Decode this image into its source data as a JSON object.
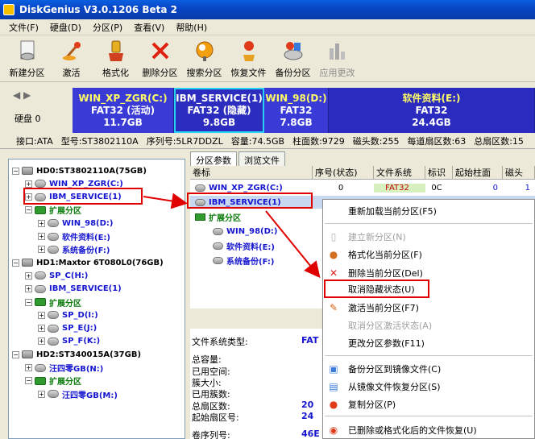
{
  "window": {
    "title": "DiskGenius V3.0.1206 Beta 2"
  },
  "menu": [
    "文件(F)",
    "硬盘(D)",
    "分区(P)",
    "查看(V)",
    "帮助(H)"
  ],
  "toolbar": [
    {
      "label": "新建分区",
      "icon": "new-partition-icon",
      "enabled": true
    },
    {
      "label": "激活",
      "icon": "activate-icon",
      "enabled": true
    },
    {
      "label": "格式化",
      "icon": "format-icon",
      "enabled": true
    },
    {
      "label": "删除分区",
      "icon": "delete-icon",
      "enabled": true
    },
    {
      "label": "搜索分区",
      "icon": "search-icon",
      "enabled": true
    },
    {
      "label": "恢复文件",
      "icon": "recover-icon",
      "enabled": true
    },
    {
      "label": "备份分区",
      "icon": "backup-icon",
      "enabled": true
    },
    {
      "label": "应用更改",
      "icon": "apply-icon",
      "enabled": false
    }
  ],
  "diskbar": {
    "disk_label": "硬盘 0",
    "partitions": [
      {
        "name": "WIN_XP_ZGR(C:)",
        "fs": "FAT32 (活动)",
        "size": "11.7GB"
      },
      {
        "name": "IBM_SERVICE(1)",
        "fs": "FAT32 (隐藏)",
        "size": "9.8GB"
      },
      {
        "name": "WIN_98(D:)",
        "fs": "FAT32",
        "size": "7.8GB"
      },
      {
        "name": "软件资料(E:)",
        "fs": "FAT32",
        "size": "24.4GB"
      }
    ]
  },
  "infobar": [
    "接口:ATA",
    "型号:ST3802110A",
    "序列号:5LR7DDZL",
    "容量:74.5GB",
    "柱面数:9729",
    "磁头数:255",
    "每道扇区数:63",
    "总扇区数:15"
  ],
  "tree": [
    {
      "label": "HD0:ST3802110A(75GB)",
      "color": "black",
      "type": "hd",
      "level": 0,
      "pm": "−"
    },
    {
      "label": "WIN_XP_ZGR(C:)",
      "color": "blue",
      "type": "pt",
      "level": 1,
      "pm": "+"
    },
    {
      "label": "IBM_SERVICE(1)",
      "color": "blue",
      "type": "pt",
      "level": 1,
      "pm": "+"
    },
    {
      "label": "扩展分区",
      "color": "green",
      "type": "ex",
      "level": 1,
      "pm": "−"
    },
    {
      "label": "WIN_98(D:)",
      "color": "blue",
      "type": "pt",
      "level": 2,
      "pm": "+"
    },
    {
      "label": "软件资料(E:)",
      "color": "blue",
      "type": "pt",
      "level": 2,
      "pm": "+"
    },
    {
      "label": "系统备份(F:)",
      "color": "blue",
      "type": "pt",
      "level": 2,
      "pm": "+"
    },
    {
      "label": "HD1:Maxtor 6T080L0(76GB)",
      "color": "black",
      "type": "hd",
      "level": 0,
      "pm": "−"
    },
    {
      "label": "SP_C(H:)",
      "color": "blue",
      "type": "pt",
      "level": 1,
      "pm": "+"
    },
    {
      "label": "IBM_SERVICE(1)",
      "color": "blue",
      "type": "pt",
      "level": 1,
      "pm": "+"
    },
    {
      "label": "扩展分区",
      "color": "green",
      "type": "ex",
      "level": 1,
      "pm": "−"
    },
    {
      "label": "SP_D(I:)",
      "color": "blue",
      "type": "pt",
      "level": 2,
      "pm": "+"
    },
    {
      "label": "SP_E(J:)",
      "color": "blue",
      "type": "pt",
      "level": 2,
      "pm": "+"
    },
    {
      "label": "SP_F(K:)",
      "color": "blue",
      "type": "pt",
      "level": 2,
      "pm": "+"
    },
    {
      "label": "HD2:ST340015A(37GB)",
      "color": "black",
      "type": "hd",
      "level": 0,
      "pm": "−"
    },
    {
      "label": "汪四零GB(N:)",
      "color": "blue",
      "type": "pt",
      "level": 1,
      "pm": "+"
    },
    {
      "label": "扩展分区",
      "color": "green",
      "type": "ex",
      "level": 1,
      "pm": "−"
    },
    {
      "label": "汪四零GB(M:)",
      "color": "blue",
      "type": "pt",
      "level": 2,
      "pm": "+"
    }
  ],
  "tabs": [
    "分区参数",
    "浏览文件"
  ],
  "columns": [
    "卷标",
    "序号(状态)",
    "文件系统",
    "标识",
    "起始柱面",
    "磁头"
  ],
  "rows": [
    {
      "label": "WIN_XP_ZGR(C:)",
      "num": "0",
      "fs": "FAT32",
      "id": "0C",
      "cyl": "0",
      "head": "1",
      "color": "blue",
      "level": 0
    },
    {
      "label": "IBM_SERVICE(1)",
      "num": "",
      "fs": "",
      "id": "",
      "cyl": "",
      "head": "",
      "color": "blue",
      "level": 0
    },
    {
      "label": "扩展分区",
      "num": "",
      "fs": "",
      "id": "",
      "cyl": "",
      "head": "",
      "color": "green",
      "level": 0
    },
    {
      "label": "WIN_98(D:)",
      "num": "",
      "fs": "",
      "id": "",
      "cyl": "",
      "head": "",
      "color": "blue",
      "level": 1
    },
    {
      "label": "软件资料(E:)",
      "num": "",
      "fs": "",
      "id": "",
      "cyl": "",
      "head": "",
      "color": "blue",
      "level": 1
    },
    {
      "label": "系统备份(F:)",
      "num": "",
      "fs": "",
      "id": "",
      "cyl": "",
      "head": "",
      "color": "blue",
      "level": 1
    }
  ],
  "details": [
    {
      "label": "文件系统类型:",
      "value": "FAT"
    },
    {
      "label": "总容量:",
      "value": ""
    },
    {
      "label": "已用空间:",
      "value": ""
    },
    {
      "label": "簇大小:",
      "value": ""
    },
    {
      "label": "已用簇数:",
      "value": ""
    },
    {
      "label": "总扇区数:",
      "value": "20"
    },
    {
      "label": "起始扇区号:",
      "value": "24"
    },
    {
      "label": "卷序列号:",
      "value": "46E"
    }
  ],
  "context_menu": [
    {
      "label": "重新加载当前分区(F5)",
      "icon": "",
      "enabled": true
    },
    {
      "label": "建立新分区(N)",
      "icon": "new-partition-icon",
      "enabled": false
    },
    {
      "label": "格式化当前分区(F)",
      "icon": "format-icon",
      "enabled": true
    },
    {
      "label": "删除当前分区(Del)",
      "icon": "delete-icon",
      "enabled": true
    },
    {
      "label": "取消隐藏状态(U)",
      "icon": "",
      "enabled": true
    },
    {
      "label": "激活当前分区(F7)",
      "icon": "activate-icon",
      "enabled": true
    },
    {
      "label": "取消分区激活状态(A)",
      "icon": "",
      "enabled": false
    },
    {
      "label": "更改分区参数(F11)",
      "icon": "",
      "enabled": true
    },
    {
      "label": "备份分区到镜像文件(C)",
      "icon": "backup-icon",
      "enabled": true
    },
    {
      "label": "从镜像文件恢复分区(S)",
      "icon": "restore-icon",
      "enabled": true
    },
    {
      "label": "复制分区(P)",
      "icon": "copy-icon",
      "enabled": true
    },
    {
      "label": "已删除或格式化后的文件恢复(U)",
      "icon": "recover-icon",
      "enabled": true
    }
  ],
  "colors": {
    "partition_blue": "#3a3ad6",
    "highlight_red": "#e00000",
    "selected_cyan": "#27d3f5",
    "tree_blue": "#1515d0",
    "tree_green": "#0a7a0a"
  }
}
